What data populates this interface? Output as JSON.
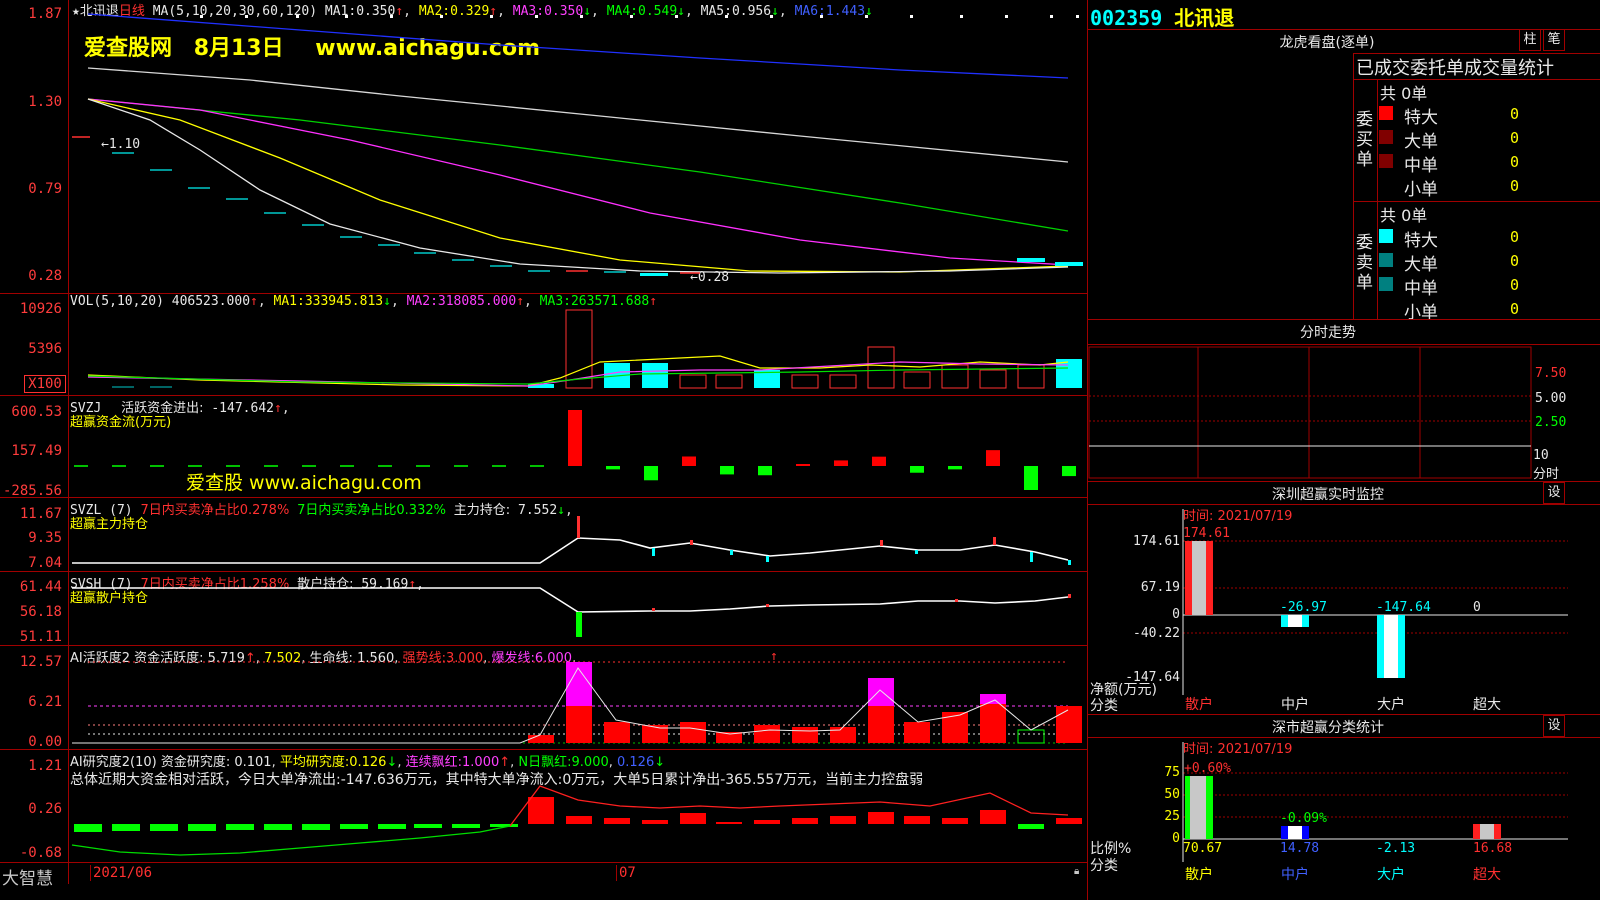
{
  "app": {
    "brand": "大智慧",
    "date_start": "2021/06",
    "date_mid": "07"
  },
  "stock": {
    "code": "002359",
    "name": "北讯退"
  },
  "watermark": {
    "site": "爱查股网",
    "date": "8月13日",
    "url": "www.aichagu.com",
    "small": "爱查股 www.aichagu.com"
  },
  "price_panel": {
    "title_name": "北讯退",
    "period": "日线",
    "ma_header": "MA(5,10,20,30,60,120)",
    "ma": [
      {
        "label": "MA1:",
        "value": "0.350",
        "arrow": "↑",
        "color": "#e8e8e8"
      },
      {
        "label": "MA2:",
        "value": "0.329",
        "arrow": "↑",
        "color": "#ffff00"
      },
      {
        "label": "MA3:",
        "value": "0.350",
        "arrow": "↓",
        "color": "#ff40ff"
      },
      {
        "label": "MA4:",
        "value": "0.549",
        "arrow": "↓",
        "color": "#00ff00"
      },
      {
        "label": "MA5:",
        "value": "0.956",
        "arrow": "↓",
        "color": "#e8e8e8"
      },
      {
        "label": "MA6:",
        "value": "1.443",
        "arrow": "↓",
        "color": "#4060ff"
      }
    ],
    "y_labels": [
      "1.87",
      "1.30",
      "0.79",
      "0.28"
    ],
    "high_mark": "1.10",
    "low_mark": "0.28"
  },
  "vol_panel": {
    "header": "VOL(5,10,20)",
    "value": "406523.000",
    "ma": [
      {
        "label": "MA1:",
        "value": "333945.813",
        "arrow": "↓",
        "color": "#ffff00"
      },
      {
        "label": "MA2:",
        "value": "318085.000",
        "arrow": "↑",
        "color": "#ff40ff"
      },
      {
        "label": "MA3:",
        "value": "263571.688",
        "arrow": "↑",
        "color": "#00ff00"
      }
    ],
    "y_labels": [
      "10926",
      "5396",
      "X100"
    ]
  },
  "svzj_panel": {
    "header": "SVZJ",
    "item": "活跃资金进出:",
    "value": "-147.642",
    "subtitle": "超赢资金流(万元)",
    "y_labels": [
      "600.53",
      "157.49",
      "-285.56"
    ],
    "bars": [
      0,
      0,
      0,
      0,
      0,
      0,
      0,
      0,
      0,
      0,
      0,
      0,
      0,
      600.53,
      -40,
      -170,
      102,
      -100,
      -110,
      10,
      60,
      100,
      -80,
      -40,
      170,
      -285.56,
      -120
    ]
  },
  "svzl_panel": {
    "header": "SVZL (7)",
    "t1": "7日内买卖净占比0.278%",
    "t2": "7日内买卖净占比0.332%",
    "t3": "主力持仓:",
    "value": "7.552",
    "subtitle": "超赢主力持仓",
    "y_labels": [
      "11.67",
      "9.35",
      "7.04"
    ]
  },
  "svsh_panel": {
    "header": "SVSH (7)",
    "t1": "7日内买卖净占比1.258%",
    "t2": "散户持仓:",
    "value": "59.169",
    "subtitle": "超赢散户持仓",
    "y_labels": [
      "61.44",
      "56.18",
      "51.11"
    ]
  },
  "ai_active_panel": {
    "header": "AI活跃度2",
    "t1": "资金活跃度:",
    "v1": "5.719",
    "v2": "7.502",
    "t2": "生命线:",
    "v3": "1.560",
    "t3": "强势线:",
    "v4": "3.000",
    "t4": "爆发线:",
    "v5": "6.000",
    "y_labels": [
      "12.57",
      "6.21",
      "0.00"
    ]
  },
  "ai_research_panel": {
    "header": "AI研究度2(10)",
    "t1": "资金研究度:",
    "v1": "0.101",
    "t2": "平均研究度:",
    "v2": "0.126",
    "t3": "连续飘红:",
    "v3": "1.000",
    "t4": "N日飘红:",
    "v4": "9.000",
    "v5": "0.126",
    "summary": "总体近期大资金相对活跃，今日大单净流出:-147.636万元，其中特大单净流入:0万元，大单5日累计净出-365.557万元，当前主力控盘弱",
    "y_labels": [
      "1.21",
      "0.26",
      "-0.68"
    ]
  },
  "right": {
    "dragon_title": "龙虎看盘(逐单)",
    "btn_zhu": "柱",
    "btn_bi": "笔",
    "stats_title": "已成交委托单成交量统计",
    "buy_label": "委买单",
    "sell_label": "委卖单",
    "buy_total": "共 0单",
    "sell_total": "共 0单",
    "buy_rows": [
      {
        "name": "特大",
        "value": "0",
        "color": "#ff0000"
      },
      {
        "name": "大单",
        "value": "0",
        "color": "#800000"
      },
      {
        "name": "中单",
        "value": "0",
        "color": "#800000"
      },
      {
        "name": "小单",
        "value": "0",
        "color": "#000000"
      }
    ],
    "sell_rows": [
      {
        "name": "特大",
        "value": "0",
        "color": "#00ffff"
      },
      {
        "name": "大单",
        "value": "0",
        "color": "#008080"
      },
      {
        "name": "中单",
        "value": "0",
        "color": "#008080"
      },
      {
        "name": "小单",
        "value": "0",
        "color": "#000000"
      }
    ],
    "intraday_title": "分时走势",
    "intraday_labels": [
      "7.50",
      "5.00",
      "2.50",
      "10",
      "分时"
    ],
    "sz_title": "深圳超赢实时监控",
    "sz_btn": "设",
    "sz_time": "时间: 2021/07/19",
    "sz_y": [
      "174.61",
      "67.19",
      "0",
      "-40.22",
      "-147.64"
    ],
    "sz_values": [
      "174.61",
      "-26.97",
      "-147.64",
      "0"
    ],
    "sz_unit": "净额(万元)",
    "sz_cat_label": "分类",
    "sz_cats": [
      "散户",
      "中户",
      "大户",
      "超大"
    ],
    "sc_title": "深市超赢分类统计",
    "sc_btn": "设",
    "sc_time": "时间: 2021/07/19",
    "sc_y": [
      "75",
      "50",
      "25",
      "0"
    ],
    "sc_top": [
      "+0.60%",
      "-0.09%"
    ],
    "sc_values": [
      "70.67",
      "14.78",
      "-2.13",
      "16.68"
    ],
    "sc_unit": "比例%",
    "sc_cat_label": "分类",
    "sc_cats": [
      "散户",
      "中户",
      "大户",
      "超大"
    ]
  }
}
